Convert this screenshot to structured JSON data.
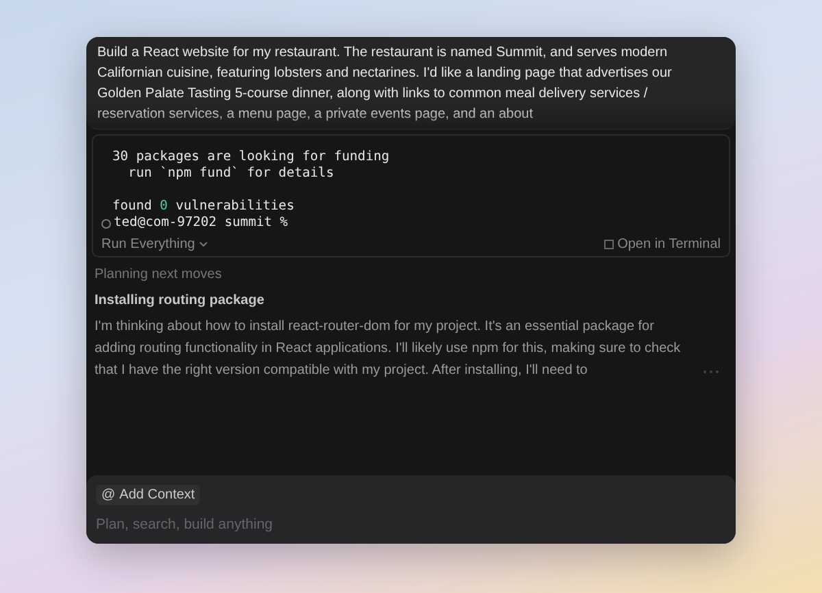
{
  "prompt": {
    "text": "Build a React website for my restaurant. The restaurant is named Summit, and serves modern Californian cuisine, featuring lobsters and nectarines. I'd like a landing page that advertises our Golden Palate Tasting 5-course dinner, along with links to common meal delivery services / reservation services, a menu page, a private events page, and an about"
  },
  "terminal": {
    "lines": [
      {
        "kind": "output",
        "segments": [
          {
            "text": "30 packages are looking for funding",
            "kind": "plain"
          }
        ]
      },
      {
        "kind": "output",
        "segments": [
          {
            "text": "  run `npm fund` for details",
            "kind": "plain"
          }
        ]
      },
      {
        "kind": "blank"
      },
      {
        "kind": "output",
        "segments": [
          {
            "text": "found ",
            "kind": "plain"
          },
          {
            "text": "0",
            "kind": "success"
          },
          {
            "text": " vulnerabilities",
            "kind": "plain"
          }
        ]
      },
      {
        "kind": "prompt",
        "segments": [
          {
            "text": "ted@com-97202 summit %",
            "kind": "plain"
          }
        ]
      }
    ],
    "run_button": "Run Everything",
    "open_button": "Open in Terminal"
  },
  "status": "Planning next moves",
  "step": {
    "title": "Installing routing package",
    "body": "I'm thinking about how to install react-router-dom for my project. It's an essential package for adding routing functionality in React applications. I'll likely use npm for this, making sure to check that I have the right version compatible with my project. After installing, I'll need to"
  },
  "composer": {
    "context_icon": "@",
    "context_button": "Add Context",
    "placeholder": "Plan, search, build anything"
  }
}
